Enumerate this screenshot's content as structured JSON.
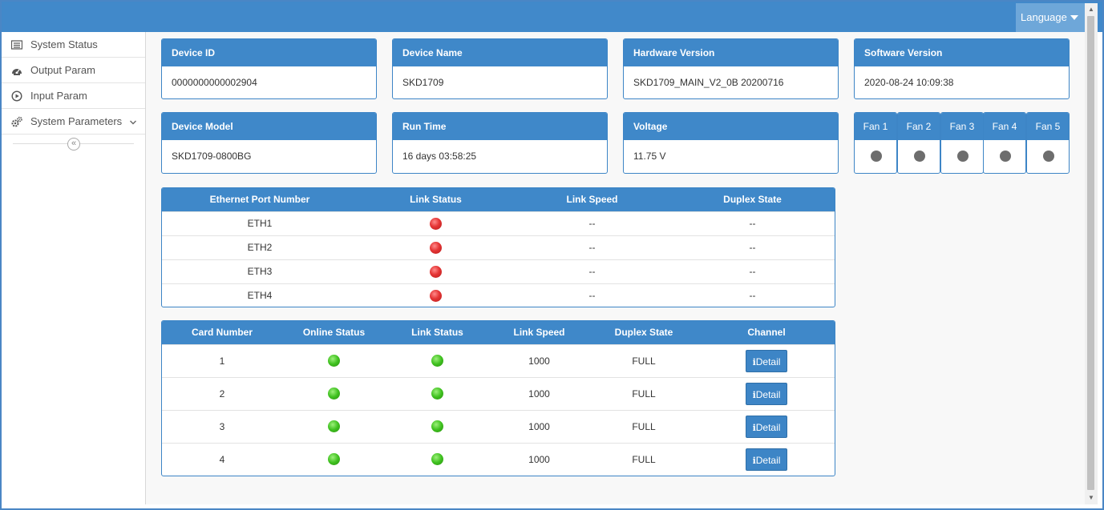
{
  "header": {
    "language_label": "Language"
  },
  "sidebar": {
    "items": [
      {
        "label": "System Status",
        "icon": "status-list-icon"
      },
      {
        "label": "Output Param",
        "icon": "output-gauge-icon"
      },
      {
        "label": "Input Param",
        "icon": "play-circle-icon"
      },
      {
        "label": "System Parameters",
        "icon": "gears-icon",
        "has_submenu": true
      }
    ],
    "collapse_glyph": "«"
  },
  "info_cards": {
    "device_id": {
      "label": "Device ID",
      "value": "0000000000002904"
    },
    "device_name": {
      "label": "Device Name",
      "value": "SKD1709"
    },
    "hardware_version": {
      "label": "Hardware Version",
      "value": "SKD1709_MAIN_V2_0B 20200716"
    },
    "software_version": {
      "label": "Software Version",
      "value": "2020-08-24 10:09:38"
    },
    "device_model": {
      "label": "Device Model",
      "value": "SKD1709-0800BG"
    },
    "run_time": {
      "label": "Run Time",
      "value": "16 days 03:58:25"
    },
    "voltage": {
      "label": "Voltage",
      "value": "11.75 V"
    }
  },
  "fans": [
    {
      "label": "Fan 1",
      "status_color": "#6d6d6d"
    },
    {
      "label": "Fan 2",
      "status_color": "#6d6d6d"
    },
    {
      "label": "Fan 3",
      "status_color": "#6d6d6d"
    },
    {
      "label": "Fan 4",
      "status_color": "#6d6d6d"
    },
    {
      "label": "Fan 5",
      "status_color": "#6d6d6d"
    }
  ],
  "ethernet_table": {
    "headers": [
      "Ethernet Port Number",
      "Link Status",
      "Link Speed",
      "Duplex State"
    ],
    "rows": [
      {
        "port": "ETH1",
        "link_status": "red",
        "speed": "--",
        "duplex": "--"
      },
      {
        "port": "ETH2",
        "link_status": "red",
        "speed": "--",
        "duplex": "--"
      },
      {
        "port": "ETH3",
        "link_status": "red",
        "speed": "--",
        "duplex": "--"
      },
      {
        "port": "ETH4",
        "link_status": "red",
        "speed": "--",
        "duplex": "--"
      }
    ]
  },
  "card_table": {
    "headers": [
      "Card Number",
      "Online Status",
      "Link Status",
      "Link Speed",
      "Duplex State",
      "Channel"
    ],
    "detail_icon_glyph": "i",
    "detail_label": "Detail",
    "rows": [
      {
        "card": "1",
        "online": "green",
        "link": "green",
        "speed": "1000",
        "duplex": "FULL"
      },
      {
        "card": "2",
        "online": "green",
        "link": "green",
        "speed": "1000",
        "duplex": "FULL"
      },
      {
        "card": "3",
        "online": "green",
        "link": "green",
        "speed": "1000",
        "duplex": "FULL"
      },
      {
        "card": "4",
        "online": "green",
        "link": "green",
        "speed": "1000",
        "duplex": "FULL"
      }
    ]
  },
  "colors": {
    "primary": "#3f88c9",
    "topbar": "#4189ca",
    "status_off": "#e53535",
    "status_on": "#3fc11f",
    "fan_unknown": "#6d6d6d"
  }
}
